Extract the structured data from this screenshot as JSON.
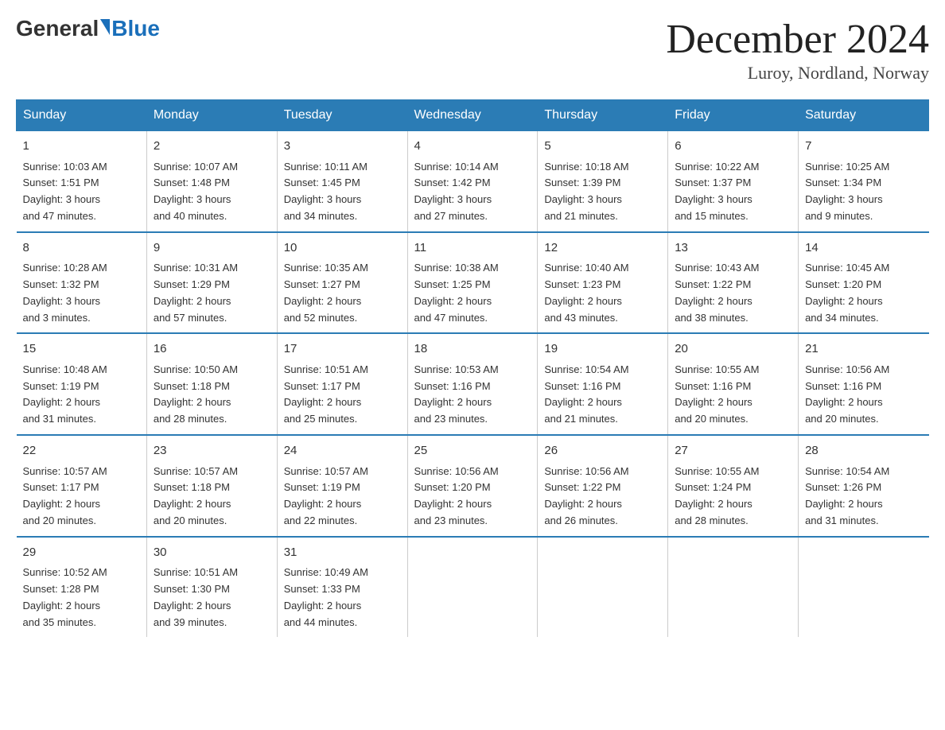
{
  "header": {
    "logo_general": "General",
    "logo_blue": "Blue",
    "month_title": "December 2024",
    "location": "Luroy, Nordland, Norway"
  },
  "days_of_week": [
    "Sunday",
    "Monday",
    "Tuesday",
    "Wednesday",
    "Thursday",
    "Friday",
    "Saturday"
  ],
  "weeks": [
    [
      {
        "num": "1",
        "sunrise": "10:03 AM",
        "sunset": "1:51 PM",
        "daylight": "3 hours and 47 minutes."
      },
      {
        "num": "2",
        "sunrise": "10:07 AM",
        "sunset": "1:48 PM",
        "daylight": "3 hours and 40 minutes."
      },
      {
        "num": "3",
        "sunrise": "10:11 AM",
        "sunset": "1:45 PM",
        "daylight": "3 hours and 34 minutes."
      },
      {
        "num": "4",
        "sunrise": "10:14 AM",
        "sunset": "1:42 PM",
        "daylight": "3 hours and 27 minutes."
      },
      {
        "num": "5",
        "sunrise": "10:18 AM",
        "sunset": "1:39 PM",
        "daylight": "3 hours and 21 minutes."
      },
      {
        "num": "6",
        "sunrise": "10:22 AM",
        "sunset": "1:37 PM",
        "daylight": "3 hours and 15 minutes."
      },
      {
        "num": "7",
        "sunrise": "10:25 AM",
        "sunset": "1:34 PM",
        "daylight": "3 hours and 9 minutes."
      }
    ],
    [
      {
        "num": "8",
        "sunrise": "10:28 AM",
        "sunset": "1:32 PM",
        "daylight": "3 hours and 3 minutes."
      },
      {
        "num": "9",
        "sunrise": "10:31 AM",
        "sunset": "1:29 PM",
        "daylight": "2 hours and 57 minutes."
      },
      {
        "num": "10",
        "sunrise": "10:35 AM",
        "sunset": "1:27 PM",
        "daylight": "2 hours and 52 minutes."
      },
      {
        "num": "11",
        "sunrise": "10:38 AM",
        "sunset": "1:25 PM",
        "daylight": "2 hours and 47 minutes."
      },
      {
        "num": "12",
        "sunrise": "10:40 AM",
        "sunset": "1:23 PM",
        "daylight": "2 hours and 43 minutes."
      },
      {
        "num": "13",
        "sunrise": "10:43 AM",
        "sunset": "1:22 PM",
        "daylight": "2 hours and 38 minutes."
      },
      {
        "num": "14",
        "sunrise": "10:45 AM",
        "sunset": "1:20 PM",
        "daylight": "2 hours and 34 minutes."
      }
    ],
    [
      {
        "num": "15",
        "sunrise": "10:48 AM",
        "sunset": "1:19 PM",
        "daylight": "2 hours and 31 minutes."
      },
      {
        "num": "16",
        "sunrise": "10:50 AM",
        "sunset": "1:18 PM",
        "daylight": "2 hours and 28 minutes."
      },
      {
        "num": "17",
        "sunrise": "10:51 AM",
        "sunset": "1:17 PM",
        "daylight": "2 hours and 25 minutes."
      },
      {
        "num": "18",
        "sunrise": "10:53 AM",
        "sunset": "1:16 PM",
        "daylight": "2 hours and 23 minutes."
      },
      {
        "num": "19",
        "sunrise": "10:54 AM",
        "sunset": "1:16 PM",
        "daylight": "2 hours and 21 minutes."
      },
      {
        "num": "20",
        "sunrise": "10:55 AM",
        "sunset": "1:16 PM",
        "daylight": "2 hours and 20 minutes."
      },
      {
        "num": "21",
        "sunrise": "10:56 AM",
        "sunset": "1:16 PM",
        "daylight": "2 hours and 20 minutes."
      }
    ],
    [
      {
        "num": "22",
        "sunrise": "10:57 AM",
        "sunset": "1:17 PM",
        "daylight": "2 hours and 20 minutes."
      },
      {
        "num": "23",
        "sunrise": "10:57 AM",
        "sunset": "1:18 PM",
        "daylight": "2 hours and 20 minutes."
      },
      {
        "num": "24",
        "sunrise": "10:57 AM",
        "sunset": "1:19 PM",
        "daylight": "2 hours and 22 minutes."
      },
      {
        "num": "25",
        "sunrise": "10:56 AM",
        "sunset": "1:20 PM",
        "daylight": "2 hours and 23 minutes."
      },
      {
        "num": "26",
        "sunrise": "10:56 AM",
        "sunset": "1:22 PM",
        "daylight": "2 hours and 26 minutes."
      },
      {
        "num": "27",
        "sunrise": "10:55 AM",
        "sunset": "1:24 PM",
        "daylight": "2 hours and 28 minutes."
      },
      {
        "num": "28",
        "sunrise": "10:54 AM",
        "sunset": "1:26 PM",
        "daylight": "2 hours and 31 minutes."
      }
    ],
    [
      {
        "num": "29",
        "sunrise": "10:52 AM",
        "sunset": "1:28 PM",
        "daylight": "2 hours and 35 minutes."
      },
      {
        "num": "30",
        "sunrise": "10:51 AM",
        "sunset": "1:30 PM",
        "daylight": "2 hours and 39 minutes."
      },
      {
        "num": "31",
        "sunrise": "10:49 AM",
        "sunset": "1:33 PM",
        "daylight": "2 hours and 44 minutes."
      },
      null,
      null,
      null,
      null
    ]
  ],
  "labels": {
    "sunrise": "Sunrise:",
    "sunset": "Sunset:",
    "daylight": "Daylight:"
  }
}
